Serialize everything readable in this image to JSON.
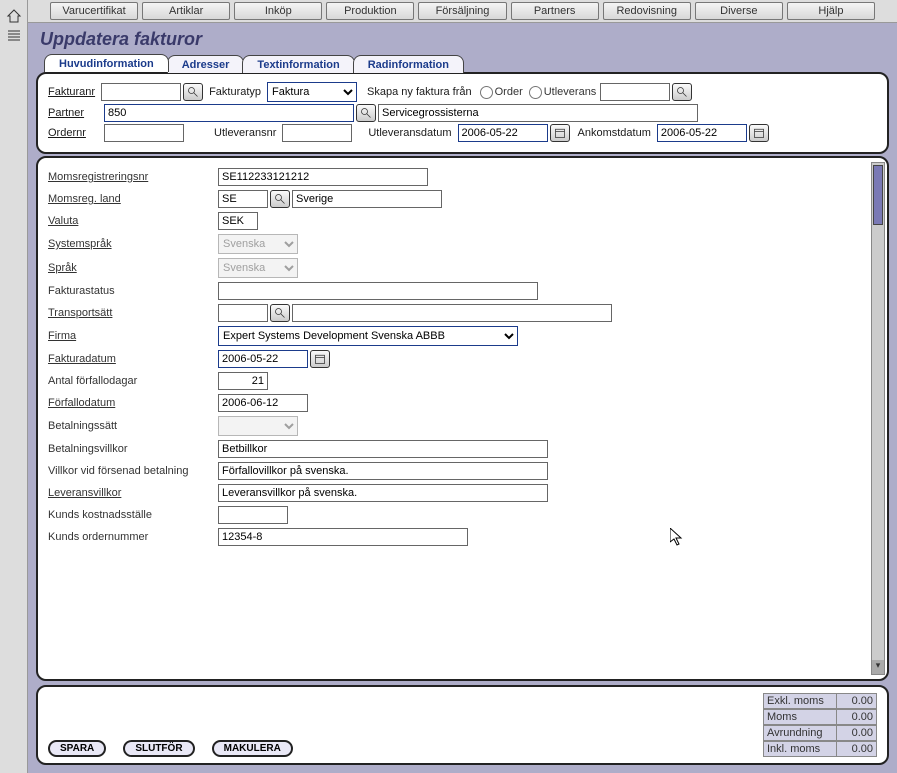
{
  "menu": [
    "Varucertifikat",
    "Artiklar",
    "Inköp",
    "Produktion",
    "Försäljning",
    "Partners",
    "Redovisning",
    "Diverse",
    "Hjälp"
  ],
  "page_title": "Uppdatera fakturor",
  "tabs": {
    "t0": "Huvudinformation",
    "t1": "Adresser",
    "t2": "Textinformation",
    "t3": "Radinformation"
  },
  "upper": {
    "fakturanr_label": "Fakturanr",
    "fakturanr_value": "",
    "fakturatyp_label": "Fakturatyp",
    "fakturatyp_value": "Faktura",
    "skapa_label": "Skapa ny faktura från",
    "order_label": "Order",
    "utleverans_label": "Utleverans",
    "utleverans_value": "",
    "partner_label": "Partner",
    "partner_value": "850",
    "partner_name": "Servicegrossisterna",
    "ordernr_label": "Ordernr",
    "ordernr_value": "",
    "utleveransnr_label": "Utleveransnr",
    "utleveransnr_value": "",
    "utleveransdatum_label": "Utleveransdatum",
    "utleveransdatum_value": "2006-05-22",
    "ankomstdatum_label": "Ankomstdatum",
    "ankomstdatum_value": "2006-05-22"
  },
  "details": {
    "momsreg_label": "Momsregistreringsnr",
    "momsreg_value": "SE112233121212",
    "momsland_label": "Momsreg. land",
    "momsland_code": "SE",
    "momsland_name": "Sverige",
    "valuta_label": "Valuta",
    "valuta_value": "SEK",
    "systemsprak_label": "Systemspråk",
    "systemsprak_value": "Svenska",
    "sprak_label": "Språk",
    "sprak_value": "Svenska",
    "fakturastatus_label": "Fakturastatus",
    "fakturastatus_value": "",
    "transportsatt_label": "Transportsätt",
    "transportsatt_code": "",
    "transportsatt_name": "",
    "firma_label": "Firma",
    "firma_value": "Expert Systems Development Svenska ABBB",
    "fakturadatum_label": "Fakturadatum",
    "fakturadatum_value": "2006-05-22",
    "antal_forf_label": "Antal förfallodagar",
    "antal_forf_value": "21",
    "forfallodatum_label": "Förfallodatum",
    "forfallodatum_value": "2006-06-12",
    "betalningssatt_label": "Betalningssätt",
    "betalningssatt_value": "",
    "betalningsvillkor_label": "Betalningsvillkor",
    "betalningsvillkor_value": "Betbillkor",
    "villkor_forsenad_label": "Villkor vid försenad betalning",
    "villkor_forsenad_value": "Förfallovillkor på svenska.",
    "leveransvillkor_label": "Leveransvillkor",
    "leveransvillkor_value": "Leveransvillkor på svenska.",
    "kunds_kostnad_label": "Kunds kostnadsställe",
    "kunds_kostnad_value": "",
    "kunds_ordernr_label": "Kunds ordernummer",
    "kunds_ordernr_value": "12354-8"
  },
  "actions": {
    "spara": "SPARA",
    "slutfor": "SLUTFÖR",
    "makulera": "MAKULERA"
  },
  "totals": {
    "exkl_label": "Exkl. moms",
    "exkl_val": "0.00",
    "moms_label": "Moms",
    "moms_val": "0.00",
    "avrund_label": "Avrundning",
    "avrund_val": "0.00",
    "inkl_label": "Inkl. moms",
    "inkl_val": "0.00"
  }
}
